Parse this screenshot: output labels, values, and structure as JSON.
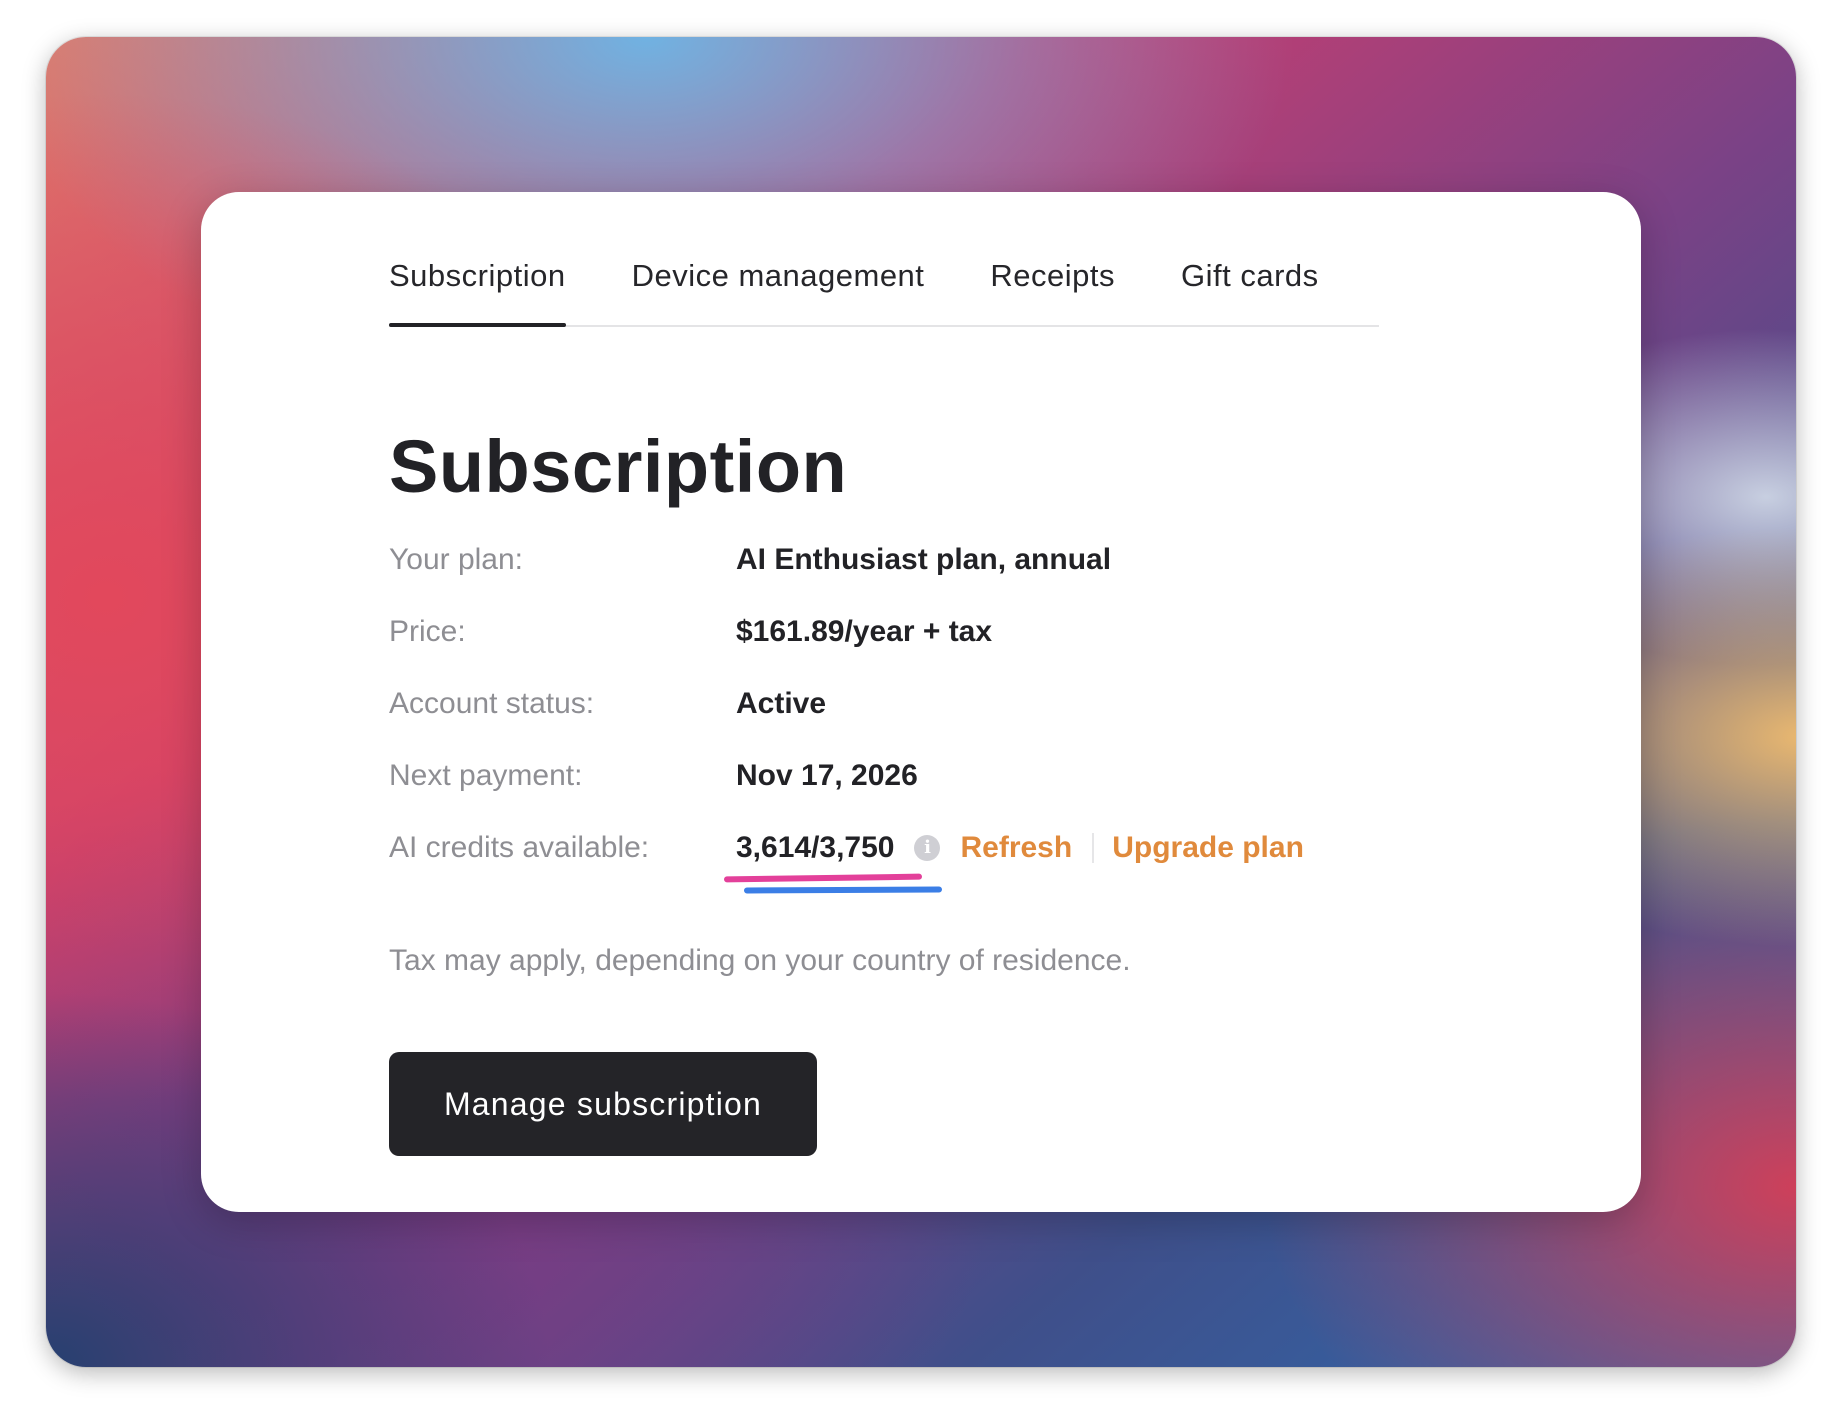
{
  "tabs": [
    {
      "label": "Subscription",
      "active": true
    },
    {
      "label": "Device management",
      "active": false
    },
    {
      "label": "Receipts",
      "active": false
    },
    {
      "label": "Gift cards",
      "active": false
    }
  ],
  "page": {
    "title": "Subscription"
  },
  "details": {
    "plan_label": "Your plan:",
    "plan_value": "AI Enthusiast plan, annual",
    "price_label": "Price:",
    "price_value": "$161.89/year + tax",
    "status_label": "Account status:",
    "status_value": "Active",
    "next_payment_label": "Next payment:",
    "next_payment_value": "Nov 17, 2026",
    "credits_label": "AI credits available:",
    "credits_value": "3,614/3,750",
    "info_icon_glyph": "i",
    "refresh_label": "Refresh",
    "upgrade_label": "Upgrade plan"
  },
  "note": "Tax may apply, depending on your country of residence.",
  "actions": {
    "manage_label": "Manage subscription"
  },
  "colors": {
    "accent_link": "#e08a3c",
    "button_bg": "#242428",
    "annotation_pink": "#e3409a",
    "annotation_blue": "#3b7ee6"
  }
}
